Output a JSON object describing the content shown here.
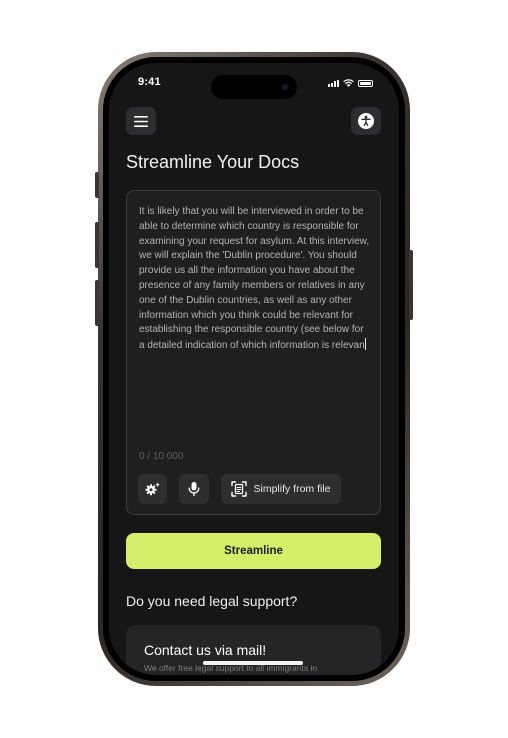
{
  "status_bar": {
    "time": "9:41"
  },
  "header": {
    "menu_icon": "hamburger-icon",
    "accessibility_icon": "accessibility-icon"
  },
  "page": {
    "title": "Streamline Your Docs"
  },
  "editor": {
    "text": "It is likely that you will be interviewed in order to be able to determine which country is responsible for examining your request for asylum. At this interview, we will explain the 'Dublin procedure'. You should provide us all the information you have about the presence of any family members or relatives in any one of the Dublin countries, as well as any other information which you think could be relevant for establishing the responsible country (see below for a detailed indication of which information is relevan",
    "char_count": "0 / 10 000"
  },
  "tools": {
    "settings_icon": "gear-sparkle-icon",
    "mic_icon": "microphone-icon",
    "file_icon": "document-scan-icon",
    "simplify_file_label": "Simplify from file"
  },
  "primary": {
    "label": "Streamline"
  },
  "support": {
    "question": "Do you need legal support?"
  },
  "contact": {
    "title": "Contact us via mail!",
    "subtitle": "We offer free legal support to all immigrants in"
  },
  "colors": {
    "accent": "#d3ef6a",
    "background": "#161617",
    "card": "#1f1f21"
  }
}
